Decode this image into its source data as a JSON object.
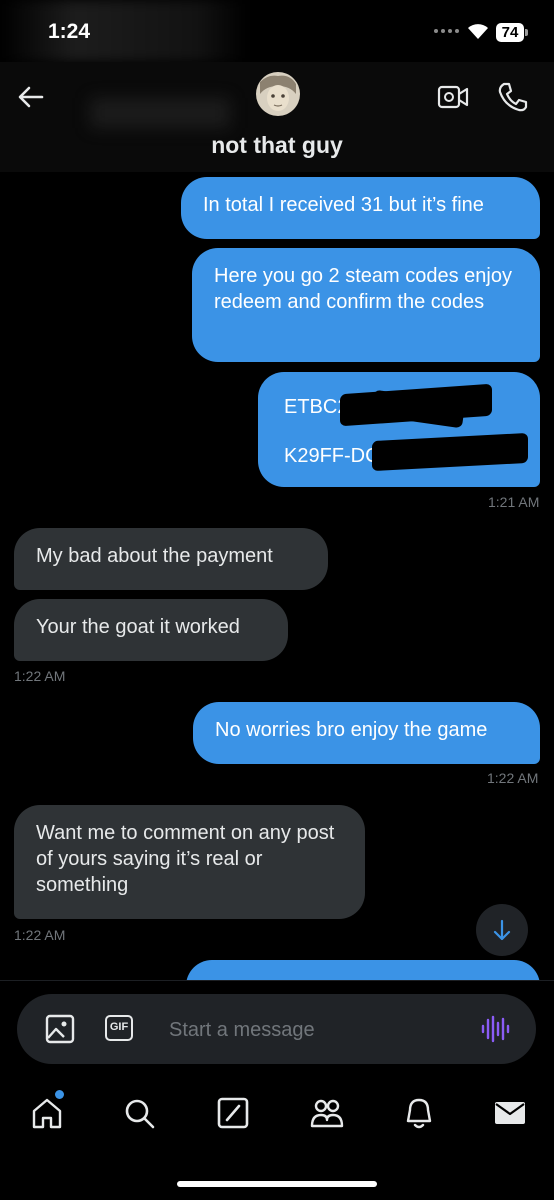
{
  "status": {
    "time": "1:24",
    "battery": "74"
  },
  "header": {
    "contact_name": "not that guy"
  },
  "messages": [
    {
      "dir": "out",
      "text": "In total I received 31 but it’s fine"
    },
    {
      "dir": "out",
      "text": "Here you go 2 steam codes enjoy redeem and confirm the codes"
    },
    {
      "dir": "out",
      "code_1": "ETBC2-",
      "code_2": "K29FF-DC",
      "time": "1:21 AM"
    },
    {
      "dir": "in",
      "text": "My bad about the payment"
    },
    {
      "dir": "in",
      "text": "Your the goat it worked",
      "time": "1:22 AM"
    },
    {
      "dir": "out",
      "text": "No worries bro enjoy the game",
      "time": "1:22 AM"
    },
    {
      "dir": "in",
      "text": "Want me to comment on any post of yours saying it’s real or something",
      "time": "1:22 AM"
    }
  ],
  "composer": {
    "placeholder": "Start a message",
    "gif_label": "GIF"
  },
  "tabs": [
    "home",
    "search",
    "grok",
    "communities",
    "notifications",
    "messages"
  ],
  "colors": {
    "accent": "#3b93e6",
    "incoming_bubble": "#2f3336",
    "voice_icon": "#8b5cf6"
  }
}
